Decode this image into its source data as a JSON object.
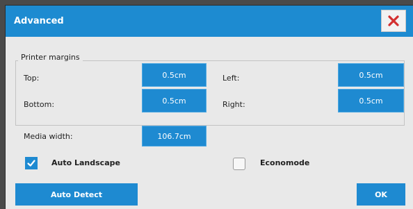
{
  "dialog": {
    "title": "Advanced",
    "close_icon": "close-x-icon",
    "accent_color": "#1d8bd1",
    "close_color": "#d32f2f"
  },
  "printer_margins": {
    "legend": "Printer margins",
    "top_label": "Top:",
    "top_value": "0.5cm",
    "left_label": "Left:",
    "left_value": "0.5cm",
    "bottom_label": "Bottom:",
    "bottom_value": "0.5cm",
    "right_label": "Right:",
    "right_value": "0.5cm"
  },
  "media": {
    "width_label": "Media width:",
    "width_value": "106.7cm"
  },
  "options": {
    "auto_landscape_label": "Auto Landscape",
    "auto_landscape_checked": true,
    "economode_label": "Economode",
    "economode_checked": false
  },
  "buttons": {
    "auto_detect": "Auto Detect",
    "ok": "OK"
  }
}
